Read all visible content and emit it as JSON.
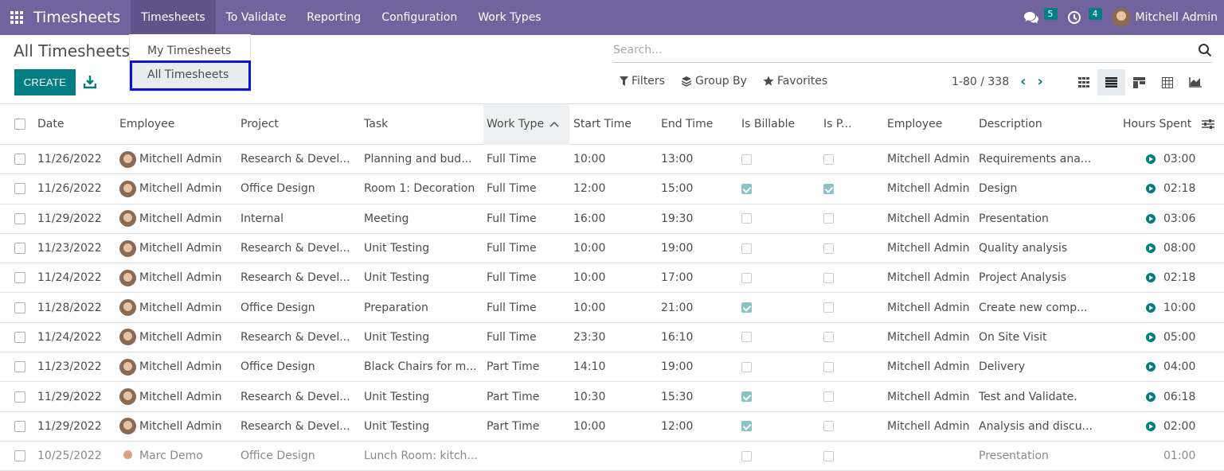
{
  "navbar": {
    "app_name": "Timesheets",
    "menu": [
      "Timesheets",
      "To Validate",
      "Reporting",
      "Configuration",
      "Work Types"
    ],
    "messages_count": "5",
    "activities_count": "4",
    "user_name": "Mitchell Admin",
    "bg_color": "#71639e"
  },
  "dropdown": {
    "items": [
      "My Timesheets",
      "All Timesheets"
    ]
  },
  "page": {
    "title": "All Timesheets",
    "create_label": "CREATE"
  },
  "search": {
    "placeholder": "Search..."
  },
  "filters": {
    "filters_label": "Filters",
    "groupby_label": "Group By",
    "favorites_label": "Favorites"
  },
  "pager": {
    "range": "1-80 / 338"
  },
  "columns": {
    "date": "Date",
    "employee": "Employee",
    "project": "Project",
    "task": "Task",
    "work_type": "Work Type",
    "start_time": "Start Time",
    "end_time": "End Time",
    "is_billable": "Is Billable",
    "is_p": "Is P...",
    "employee2": "Employee",
    "description": "Description",
    "hours": "Hours Spent"
  },
  "rows": [
    {
      "date": "11/26/2022",
      "employee": "Mitchell Admin",
      "project": "Research & Devel...",
      "task": "Planning and bud...",
      "work_type": "Full Time",
      "start": "10:00",
      "end": "13:00",
      "billable": false,
      "isp": false,
      "employee2": "Mitchell Admin",
      "description": "Requirements ana...",
      "hours": "03:00"
    },
    {
      "date": "11/26/2022",
      "employee": "Mitchell Admin",
      "project": "Office Design",
      "task": "Room 1: Decoration",
      "work_type": "Full Time",
      "start": "12:00",
      "end": "15:00",
      "billable": true,
      "isp": true,
      "employee2": "Mitchell Admin",
      "description": "Design",
      "hours": "02:18"
    },
    {
      "date": "11/29/2022",
      "employee": "Mitchell Admin",
      "project": "Internal",
      "task": "Meeting",
      "work_type": "Full Time",
      "start": "16:00",
      "end": "19:30",
      "billable": false,
      "isp": false,
      "employee2": "Mitchell Admin",
      "description": "Presentation",
      "hours": "03:06"
    },
    {
      "date": "11/23/2022",
      "employee": "Mitchell Admin",
      "project": "Research & Devel...",
      "task": "Unit Testing",
      "work_type": "Full Time",
      "start": "10:00",
      "end": "19:00",
      "billable": false,
      "isp": false,
      "employee2": "Mitchell Admin",
      "description": "Quality analysis",
      "hours": "08:00"
    },
    {
      "date": "11/24/2022",
      "employee": "Mitchell Admin",
      "project": "Research & Devel...",
      "task": "Unit Testing",
      "work_type": "Full Time",
      "start": "10:00",
      "end": "17:00",
      "billable": false,
      "isp": false,
      "employee2": "Mitchell Admin",
      "description": "Project Analysis",
      "hours": "02:18"
    },
    {
      "date": "11/28/2022",
      "employee": "Mitchell Admin",
      "project": "Office Design",
      "task": "Preparation",
      "work_type": "Full Time",
      "start": "10:00",
      "end": "21:00",
      "billable": true,
      "isp": false,
      "employee2": "Mitchell Admin",
      "description": "Create new comp...",
      "hours": "10:00"
    },
    {
      "date": "11/24/2022",
      "employee": "Mitchell Admin",
      "project": "Research & Devel...",
      "task": "Unit Testing",
      "work_type": "Full Time",
      "start": "23:30",
      "end": "16:10",
      "billable": false,
      "isp": false,
      "employee2": "Mitchell Admin",
      "description": "On Site Visit",
      "hours": "05:00"
    },
    {
      "date": "11/23/2022",
      "employee": "Mitchell Admin",
      "project": "Office Design",
      "task": "Black Chairs for m...",
      "work_type": "Part Time",
      "start": "14:10",
      "end": "19:00",
      "billable": false,
      "isp": false,
      "employee2": "Mitchell Admin",
      "description": "Delivery",
      "hours": "04:00"
    },
    {
      "date": "11/29/2022",
      "employee": "Mitchell Admin",
      "project": "Research & Devel...",
      "task": "Unit Testing",
      "work_type": "Part Time",
      "start": "10:30",
      "end": "15:30",
      "billable": true,
      "isp": false,
      "employee2": "Mitchell Admin",
      "description": "Test and Validate.",
      "hours": "06:18"
    },
    {
      "date": "11/29/2022",
      "employee": "Mitchell Admin",
      "project": "Research & Devel...",
      "task": "Unit Testing",
      "work_type": "Part Time",
      "start": "10:00",
      "end": "12:00",
      "billable": true,
      "isp": false,
      "employee2": "Mitchell Admin",
      "description": "Analysis and discu...",
      "hours": "02:00"
    },
    {
      "date": "10/25/2022",
      "employee": "Marc Demo",
      "project": "Office Design",
      "task": "Lunch Room: kitch...",
      "work_type": "",
      "start": "",
      "end": "",
      "billable": false,
      "isp": false,
      "employee2": "",
      "description": "Presentation",
      "hours": "01:00",
      "muted": true
    }
  ]
}
